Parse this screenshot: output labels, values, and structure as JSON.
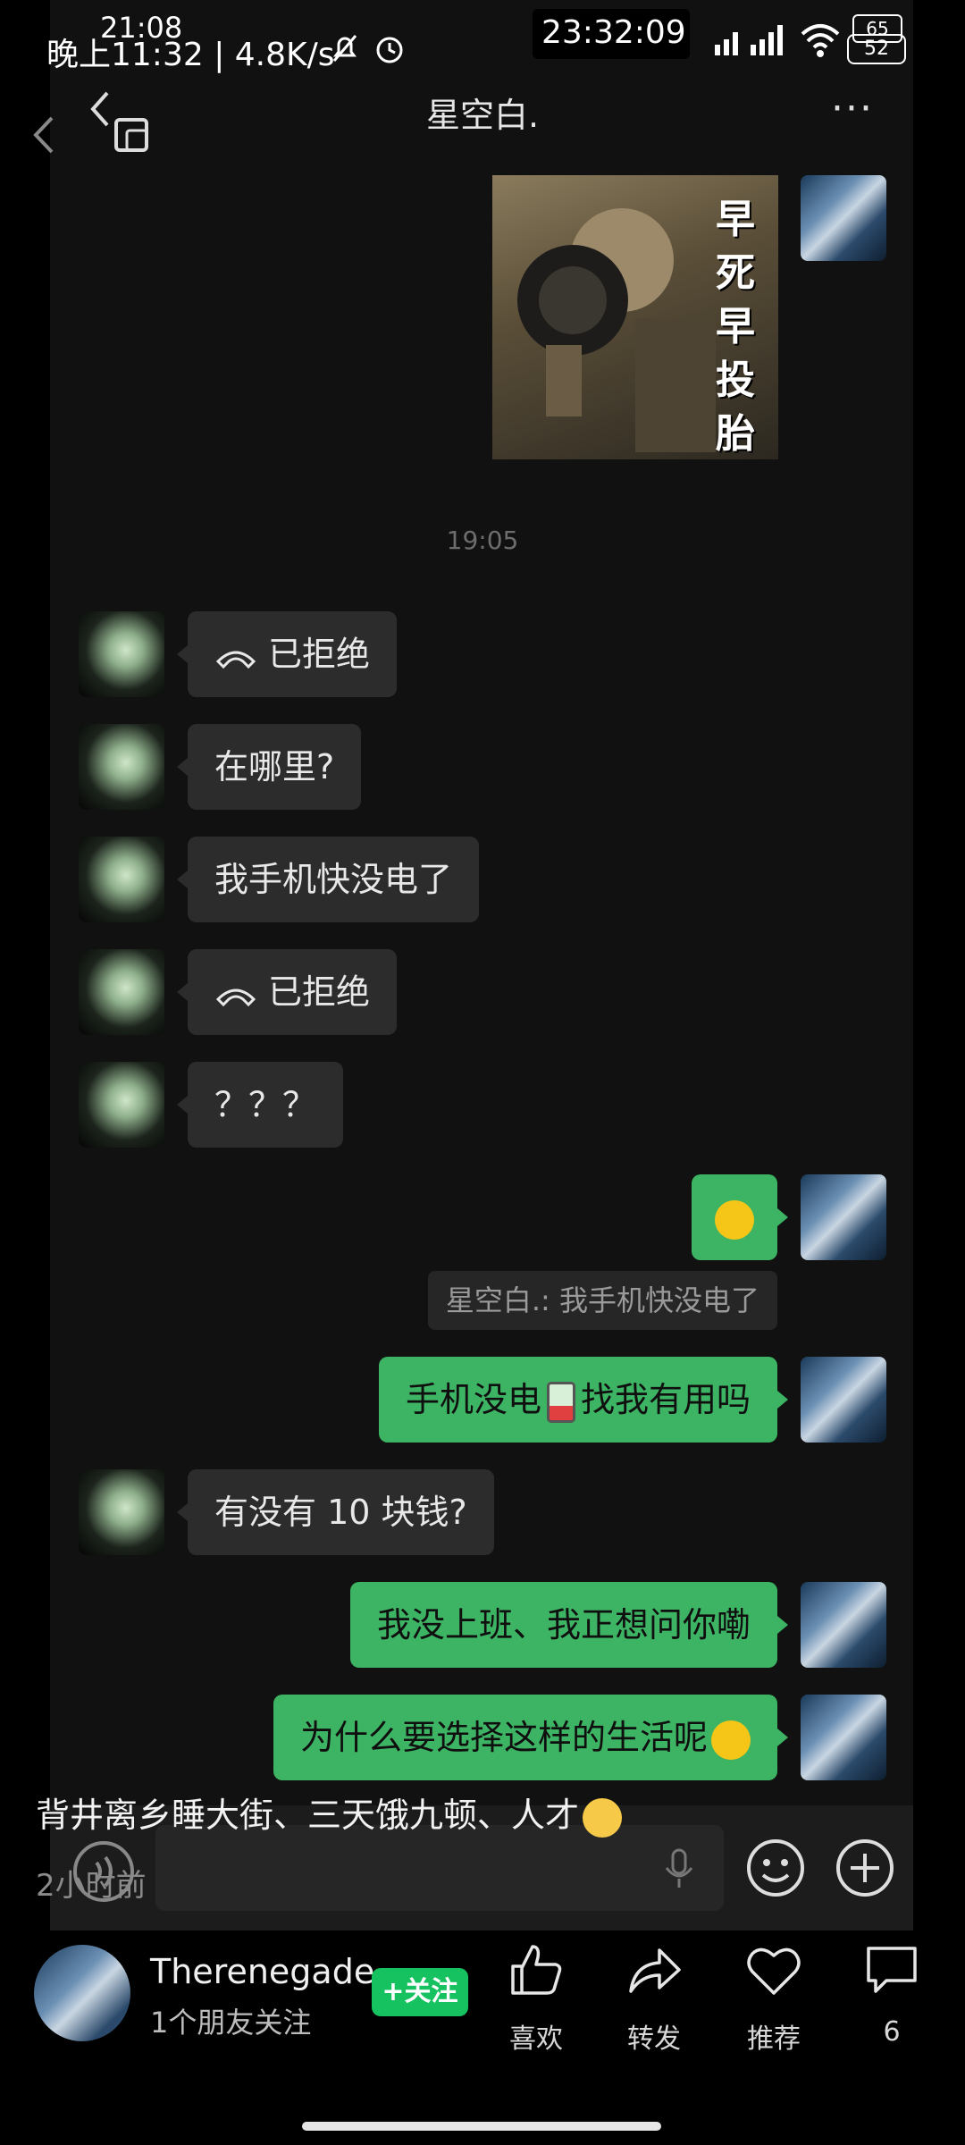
{
  "status_bar": {
    "overlay_time": "21:08",
    "left_text": "晚上11:32 | 4.8K/s",
    "clock": "23:32:09",
    "battery_overlay": "65",
    "battery": "52"
  },
  "chat": {
    "title": "星空白.",
    "time_separator": "19:05",
    "sticker_text": "早死早投胎",
    "messages": [
      {
        "side": "left",
        "text": "已拒绝",
        "kind": "call"
      },
      {
        "side": "left",
        "text": "在哪里?"
      },
      {
        "side": "left",
        "text": "我手机快没电了"
      },
      {
        "side": "left",
        "text": "已拒绝",
        "kind": "call"
      },
      {
        "side": "left",
        "text": "？？？"
      },
      {
        "side": "right",
        "kind": "emoji"
      },
      {
        "side": "right",
        "text_a": "手机没电",
        "text_b": "找我有用吗"
      },
      {
        "side": "left",
        "text": "有没有 10 块钱?"
      },
      {
        "side": "right",
        "text": "我没上班、我正想问你嘞"
      },
      {
        "side": "right",
        "text": "为什么要选择这样的生活呢"
      }
    ],
    "quote": "星空白.: 我手机快没电了"
  },
  "post": {
    "caption": "背井离乡睡大街、三天饿九顿、人才",
    "time_ago": "2小时前",
    "username": "Therenegade",
    "friends_follow": "1个朋友关注",
    "follow_button": "+关注",
    "actions": {
      "like": "喜欢",
      "share": "转发",
      "recommend": "推荐",
      "comments": "6"
    }
  }
}
